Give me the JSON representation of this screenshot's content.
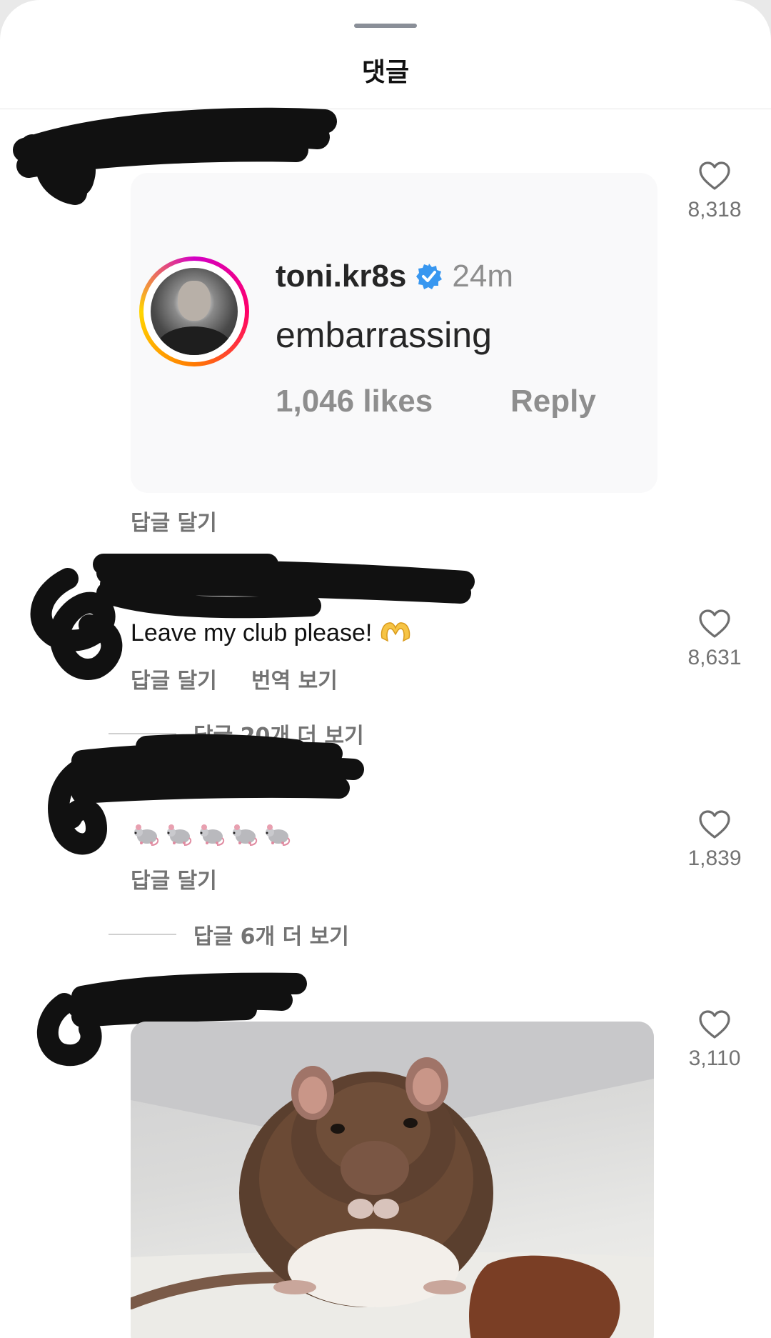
{
  "sheet": {
    "title": "댓글"
  },
  "comments": [
    {
      "like_count": "8,318",
      "embedded_screenshot": {
        "username": "toni.kr8s",
        "time": "24m",
        "text": "embarrassing",
        "likes": "1,046 likes",
        "reply_label": "Reply"
      },
      "reply_label": "답글 달기"
    },
    {
      "text": "Leave my club please! ",
      "like_count": "8,631",
      "reply_label": "답글 달기",
      "translate_label": "번역 보기",
      "view_replies": "답글 20개 더 보기"
    },
    {
      "emoji": [
        "mouse-icon",
        "mouse-icon",
        "mouse-icon",
        "mouse-icon",
        "mouse-icon"
      ],
      "like_count": "1,839",
      "reply_label": "답글 달기",
      "view_replies": "답글 6개 더 보기"
    },
    {
      "like_count": "3,110",
      "image": "rat-photo"
    }
  ],
  "colors": {
    "muted_text": "#737373",
    "verified_blue": "#3897f0",
    "redaction": "#111111"
  }
}
